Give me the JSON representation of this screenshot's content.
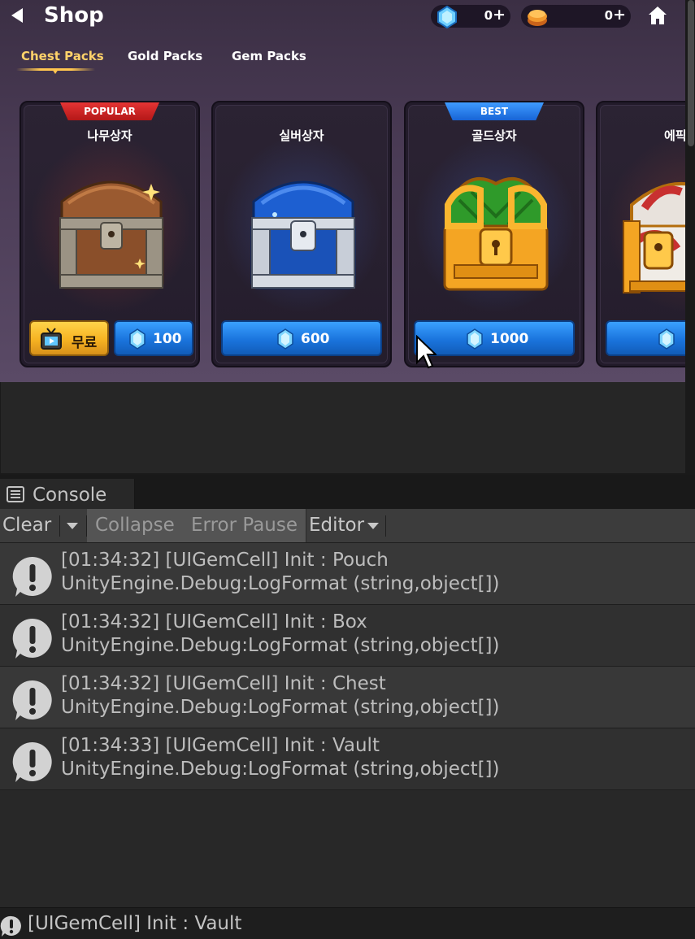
{
  "shop": {
    "title": "Shop",
    "gem_count": "0",
    "gold_count": "0",
    "plus": "+",
    "tabs": [
      {
        "label": "Chest Packs",
        "active": true
      },
      {
        "label": "Gold Packs",
        "active": false
      },
      {
        "label": "Gem Packs",
        "active": false
      }
    ],
    "cards": [
      {
        "name": "나무상자",
        "ribbon": "POPULAR",
        "ribbon_color": "#d32222",
        "chest_color": "#8a4f2a",
        "free_label": "무료",
        "price": "100"
      },
      {
        "name": "실버상자",
        "ribbon": "",
        "chest_color": "#1d5fd1",
        "price": "600"
      },
      {
        "name": "골드상자",
        "ribbon": "BEST",
        "ribbon_color": "#1e74e8",
        "chest_color": "#2f9a2a",
        "price": "1000"
      },
      {
        "name": "에픽",
        "ribbon": "",
        "chest_color": "#c83030",
        "price": ""
      }
    ]
  },
  "console": {
    "tab_label": "Console",
    "toolbar": {
      "clear": "Clear",
      "collapse": "Collapse",
      "error_pause": "Error Pause",
      "editor": "Editor"
    },
    "logs": [
      {
        "line1": "[01:34:32] [UIGemCell] Init : Pouch",
        "line2": "UnityEngine.Debug:LogFormat (string,object[])"
      },
      {
        "line1": "[01:34:32] [UIGemCell] Init : Box",
        "line2": "UnityEngine.Debug:LogFormat (string,object[])"
      },
      {
        "line1": "[01:34:32] [UIGemCell] Init : Chest",
        "line2": "UnityEngine.Debug:LogFormat (string,object[])"
      },
      {
        "line1": "[01:34:33] [UIGemCell] Init : Vault",
        "line2": "UnityEngine.Debug:LogFormat (string,object[])"
      }
    ],
    "status_text": "[UIGemCell] Init : Vault"
  }
}
